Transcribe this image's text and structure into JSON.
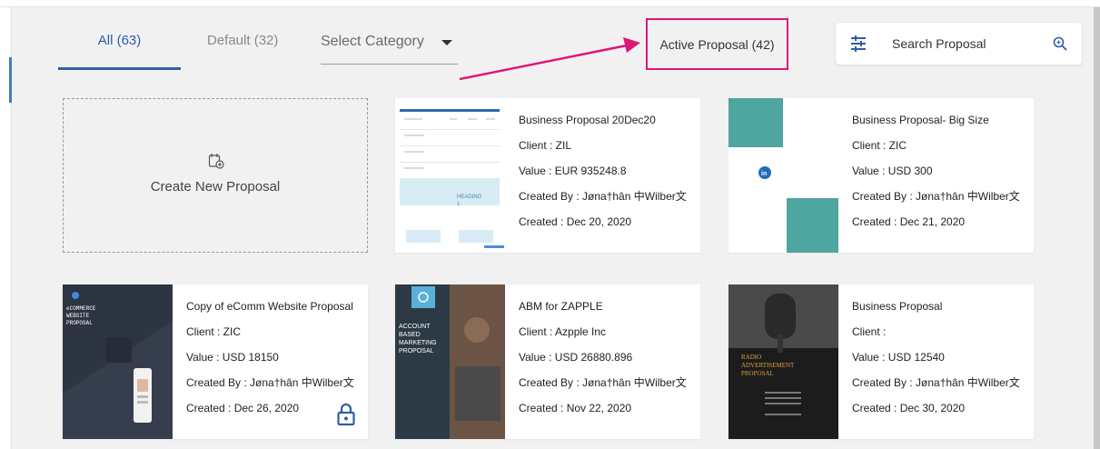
{
  "tabs": {
    "all": "All (63)",
    "default": "Default (32)",
    "select_category": "Select Category"
  },
  "active_proposal": "Active Proposal (42)",
  "search": {
    "placeholder": "Search Proposal"
  },
  "create_card": {
    "label": "Create New Proposal"
  },
  "colors": {
    "accent": "#2f5fa7",
    "highlight": "#e0157a",
    "teal": "#4fa5a0"
  },
  "cards": [
    {
      "title": "Business Proposal 20Dec20",
      "client": "Client : ZIL",
      "value": "Value : EUR 935248.8",
      "created_by": "Created By : Jøna†hân 中Wilber文",
      "created": "Created : Dec 20, 2020",
      "thumb_text": "HEADING 1"
    },
    {
      "title": "Business Proposal- Big Size",
      "client": "Client : ZIC",
      "value": "Value : USD 300",
      "created_by": "Created By : Jøna†hân 中Wilber文",
      "created": "Created : Dec 21, 2020"
    },
    {
      "title": "Copy of eComm Website Proposal",
      "client": "Client : ZIC",
      "value": "Value : USD 18150",
      "created_by": "Created By : Jøna†hân 中Wilber文",
      "created": "Created : Dec 26, 2020",
      "thumb_text": "eCOMMERCE WEBSITE PROPOSAL"
    },
    {
      "title": "ABM for ZAPPLE",
      "client": "Client : Azpple Inc",
      "value": "Value : USD 26880.896",
      "created_by": "Created By : Jøna†hân 中Wilber文",
      "created": "Created : Nov 22, 2020",
      "thumb_text": "ACCOUNT BASED MARKETING PROPOSAL"
    },
    {
      "title": "Business Proposal",
      "client": "Client :",
      "value": "Value : USD 12540",
      "created_by": "Created By : Jøna†hân 中Wilber文",
      "created": "Created : Dec 30, 2020",
      "thumb_text": "RADIO ADVERTISEMENT PROPOSAL"
    }
  ]
}
